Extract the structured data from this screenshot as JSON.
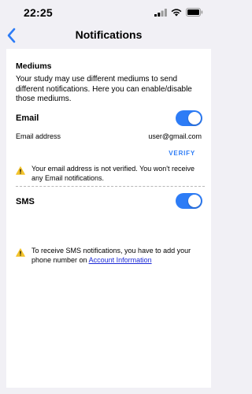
{
  "status_bar": {
    "time": "22:25"
  },
  "nav": {
    "title": "Notifications"
  },
  "mediums": {
    "title": "Mediums",
    "description": "Your study may use different mediums to send different notifications. Here you can enable/disable those mediums."
  },
  "email": {
    "label": "Email",
    "enabled": true,
    "address_label": "Email address",
    "address_value": "user@gmail.com",
    "verify_label": "VERIFY",
    "warning": "Your email address is not verified. You won't receive any Email notifications."
  },
  "sms": {
    "label": "SMS",
    "enabled": true,
    "warning_prefix": "To receive SMS notifications, you have to add your phone number on ",
    "warning_link": "Account Information"
  },
  "colors": {
    "accent": "#2d7cf6",
    "warning_icon": "#f3c32b",
    "link": "#1d2bd6"
  }
}
